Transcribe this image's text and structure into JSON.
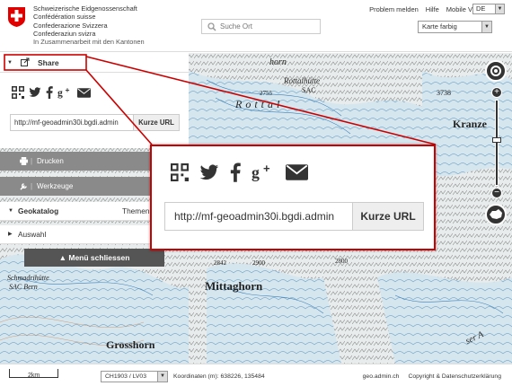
{
  "header": {
    "confederation_lines": [
      "Schweizerische Eidgenossenschaft",
      "Confédération suisse",
      "Confederazione Svizzera",
      "Confederaziun svizra"
    ],
    "collaboration": "In Zusammenarbeit mit den Kantonen",
    "search_placeholder": "Suche Ort",
    "links": {
      "report_problem": "Problem melden",
      "help": "Hilfe",
      "mobile": "Mobile Version"
    },
    "language": "DE",
    "background_layer": "Karte farbig"
  },
  "panel": {
    "share_title": "Share",
    "share_url": "http://mf-geoadmin30i.bgdi.admin",
    "short_url_button": "Kurze URL",
    "print_label": "Drucken",
    "tools_label": "Werkzeuge",
    "catalog_label": "Geokatalog",
    "catalog_extra": "Themen selek",
    "selection_label": "Auswahl",
    "close_menu_label": "▲ Menü schliessen"
  },
  "popup": {
    "share_url": "http://mf-geoadmin30i.bgdi.admin",
    "short_url_button": "Kurze URL"
  },
  "share_icons": [
    "qr-code-icon",
    "twitter-icon",
    "facebook-icon",
    "google-plus-icon",
    "mail-icon"
  ],
  "map": {
    "labels": {
      "rottalhutte": "Rottalhütte",
      "sac": "SAC",
      "rottal": "Rottal",
      "h2755": "2755",
      "h3738": "3738",
      "h2842": "2842",
      "h2900": "2900",
      "h2800": "2800",
      "krantsteine": "Kranze",
      "mittaghorn": "Mittaghorn",
      "grosshorn": "Grosshorn",
      "schmadri": "Schmadrihütte",
      "sac2": "SAC Bern",
      "ser": "ser A",
      "horn": "horn"
    }
  },
  "footer": {
    "scale": "2km",
    "crs": "CH1903 / LV03",
    "coordinates_label": "Koordinaten (m): 638226, 135484",
    "domain": "geo.admin.ch",
    "copyright": "Copyright & Datenschutzerklärung"
  },
  "colors": {
    "highlight_red": "#cc0000",
    "panel_grey": "#8a8a8a",
    "dark_button": "#555555"
  }
}
